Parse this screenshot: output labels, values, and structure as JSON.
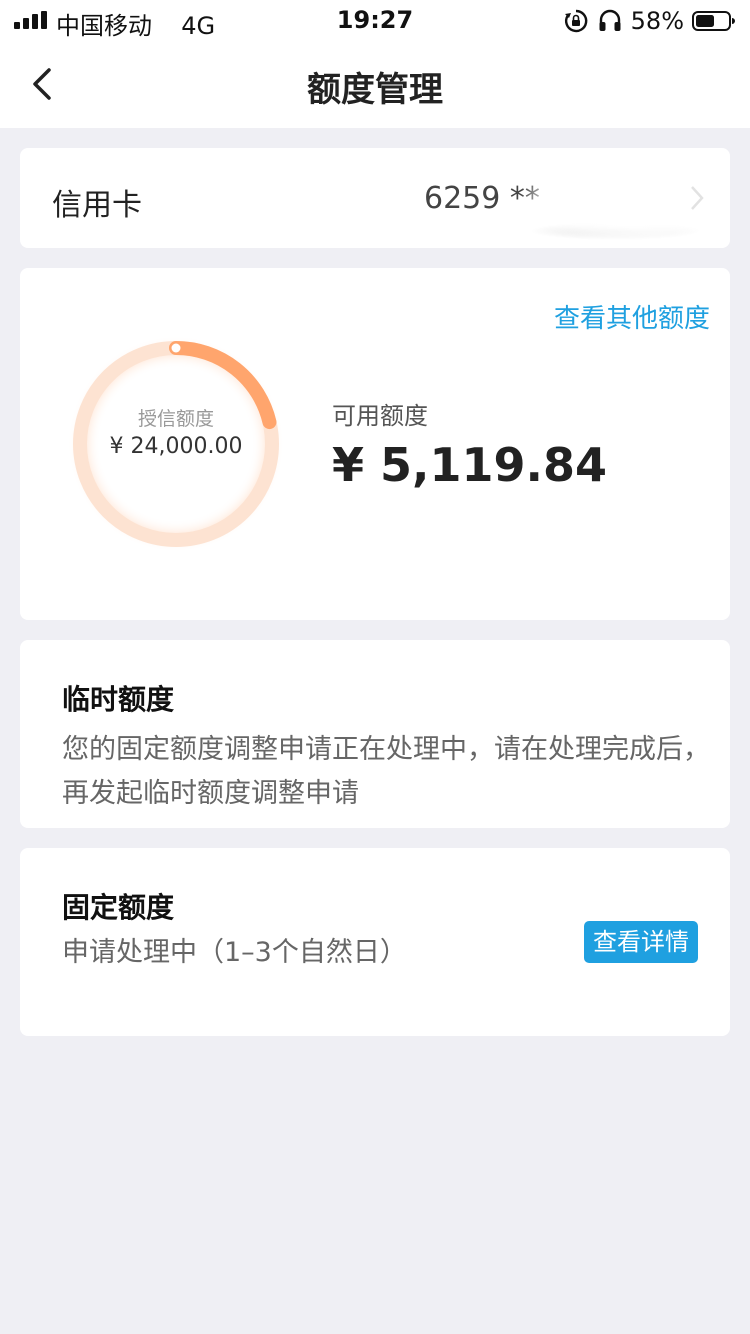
{
  "status_bar": {
    "carrier": "中国移动",
    "network": "4G",
    "time": "19:27",
    "battery_percent": "58%",
    "battery_level": 0.58
  },
  "nav": {
    "title": "额度管理"
  },
  "card_selector": {
    "type": "信用卡",
    "number": "6259 **"
  },
  "limit": {
    "view_other_label": "查看其他额度",
    "credit_label": "授信额度",
    "credit_value": "¥ 24,000.00",
    "available_label": "可用额度",
    "available_value": "¥ 5,119.84",
    "ring_fraction": 0.2133,
    "accent_color": "#ffa56d"
  },
  "temporary": {
    "title": "临时额度",
    "description": "您的固定额度调整申请正在处理中，请在处理完成后，再发起临时额度调整申请"
  },
  "fixed": {
    "title": "固定额度",
    "status": "申请处理中（1–3个自然日）",
    "details_label": "查看详情",
    "button_color": "#1fa0e0"
  }
}
